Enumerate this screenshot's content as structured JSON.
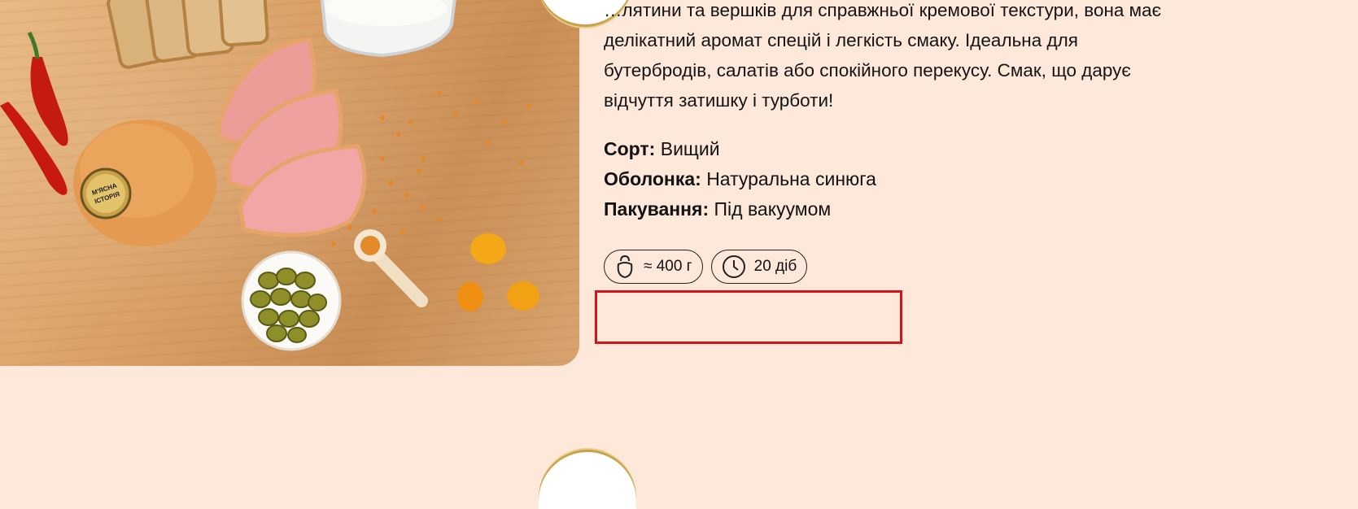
{
  "product": {
    "description_lines": [
      "…лятини та вершків для справжньої кремової текстури, вона має",
      "делікатний аромат спецій і легкість смаку. Ідеальна для",
      "бутербродів, салатів або спокійного перекусу. Смак, що дарує",
      "відчуття затишку і турботи!"
    ],
    "specs": [
      {
        "label": "Сорт:",
        "value": "Вищий"
      },
      {
        "label": "Оболонка:",
        "value": "Натуральна синюга"
      },
      {
        "label": "Пакування:",
        "value": "Під вакуумом"
      }
    ],
    "badges": [
      {
        "icon": "kettlebell-icon",
        "text": "≈ 400 г"
      },
      {
        "icon": "clock-icon",
        "text": "20 діб"
      }
    ],
    "logo_text": [
      "М'ЯСНА",
      "ІСТОРІЯ"
    ]
  },
  "colors": {
    "page_background": "#fde8da",
    "highlight_border": "#d3141b",
    "accent_gold": "#c9a24a"
  }
}
